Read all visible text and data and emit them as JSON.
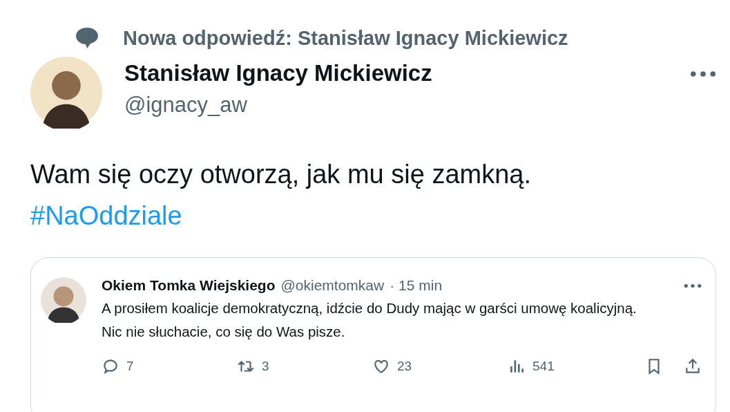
{
  "context": {
    "label": "Nowa odpowiedź: Stanisław Ignacy Mickiewicz"
  },
  "author": {
    "name": "Stanisław Ignacy Mickiewicz",
    "handle": "@ignacy_aw"
  },
  "tweet": {
    "text": "Wam się oczy otworzą, jak mu się zamkną.",
    "hashtag": "#NaOddziale"
  },
  "quote": {
    "name": "Okiem Tomka Wiejskiego",
    "handle": "@okiemtomkaw",
    "time": "· 15 min",
    "text": "A prosiłem koalicje demokratyczną, idźcie do Dudy mając w garści umowę koalicyjną. Nic nie słuchacie, co się do Was pisze.",
    "actions": [
      {
        "kind": "reply",
        "count": "7"
      },
      {
        "kind": "retweet",
        "count": "3"
      },
      {
        "kind": "like",
        "count": "23"
      },
      {
        "kind": "views",
        "count": "541"
      },
      {
        "kind": "bookmark"
      },
      {
        "kind": "share"
      }
    ]
  }
}
